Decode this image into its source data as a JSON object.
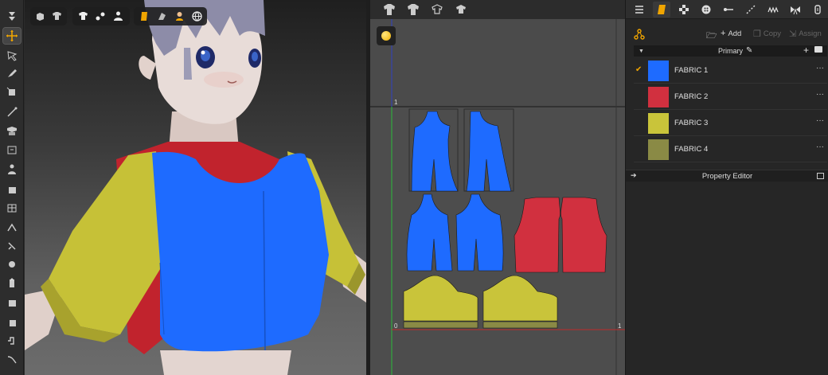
{
  "viewport": {
    "toolbar_groups": [
      [
        "avatar-box-icon",
        "avatar-shirt-icon"
      ],
      [
        "garment-icon",
        "points-icon",
        "person-icon"
      ],
      [
        "texture-icon",
        "shade-icon",
        "skin-icon",
        "globe-icon"
      ]
    ]
  },
  "left_toolbar": {
    "tools": [
      "move-down-icon",
      "transform-icon",
      "select-mesh-icon",
      "brush-icon",
      "edit-pattern-icon",
      "line-icon",
      "fold-icon",
      "pin-icon",
      "avatar-icon",
      "tack-icon",
      "grid-icon",
      "tape-icon",
      "measure-icon",
      "arrange-icon",
      "fit-icon",
      "lock-icon",
      "hanger-icon",
      "curve-icon"
    ]
  },
  "pattern_window": {
    "toolbar": [
      "pattern-shirt-icon",
      "pattern-shirt2-icon",
      "pattern-arrange-icon",
      "pattern-sym-icon"
    ],
    "axis_labels": {
      "top_one": "1",
      "origin": "0",
      "right_one": "1"
    },
    "colors": {
      "blue": "#1e6bff",
      "red": "#d1303f",
      "yellow": "#c9c43a",
      "olive": "#8a8a45"
    }
  },
  "right_panel": {
    "tabs": [
      "list-icon",
      "fabric-icon",
      "checker-icon",
      "button-icon",
      "pin-line-icon",
      "topstitch-icon",
      "zigzag-icon",
      "bow-icon",
      "zip-icon"
    ],
    "actions": {
      "add_label": "Add",
      "copy_label": "Copy",
      "assign_label": "Assign"
    },
    "group": {
      "title": "Primary"
    },
    "fabrics": [
      {
        "name": "FABRIC 1",
        "color": "#1e6bff",
        "checked": true,
        "more": "···"
      },
      {
        "name": "FABRIC 2",
        "color": "#d1303f",
        "checked": false,
        "more": "···"
      },
      {
        "name": "FABRIC 3",
        "color": "#c9c43a",
        "checked": false,
        "more": "···"
      },
      {
        "name": "FABRIC 4",
        "color": "#8a8a45",
        "checked": false,
        "more": "···"
      }
    ],
    "property_editor": {
      "title": "Property Editor"
    }
  }
}
